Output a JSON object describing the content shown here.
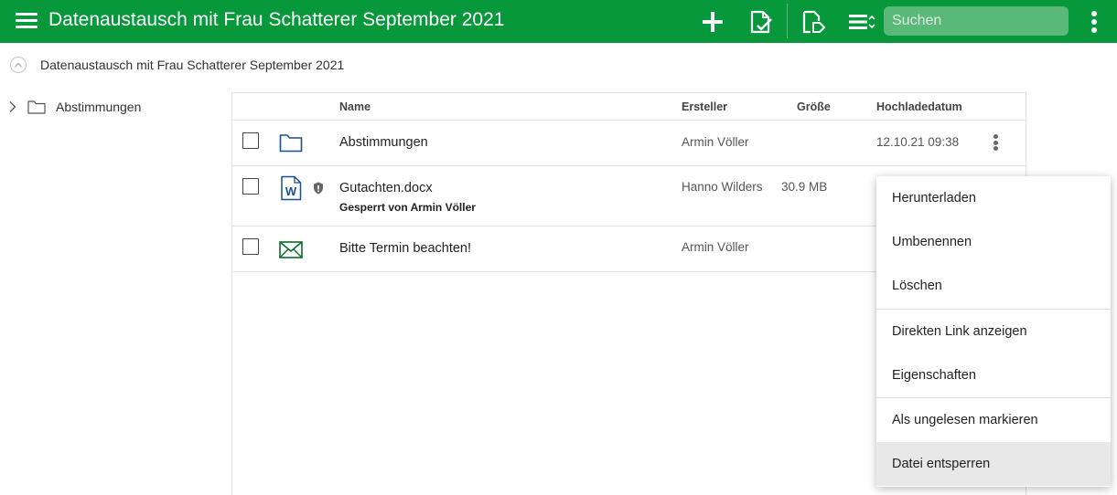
{
  "topbar": {
    "title": "Datenaustausch mit Frau Schatterer September 2021",
    "search_placeholder": "Suchen",
    "color": "#06983a"
  },
  "breadcrumb": {
    "path": "Datenaustausch mit Frau Schatterer September 2021"
  },
  "tree": {
    "items": [
      {
        "label": "Abstimmungen",
        "icon": "folder-icon"
      }
    ]
  },
  "list": {
    "columns": {
      "name": "Name",
      "creator": "Ersteller",
      "size": "Größe",
      "date": "Hochladedatum"
    },
    "rows": [
      {
        "name": "Abstimmungen",
        "sub": "",
        "creator": "Armin Völler",
        "size": "",
        "date": "12.10.21 09:38",
        "icon": "folder-icon"
      },
      {
        "name": "Gutachten.docx",
        "sub": "Gesperrt von Armin Völler",
        "creator": "Hanno Wilders",
        "size": "30.9 MB",
        "date": "",
        "icon": "word-document-icon",
        "locked": true
      },
      {
        "name": "Bitte Termin beachten!",
        "sub": "",
        "creator": "Armin Völler",
        "size": "",
        "date": "",
        "icon": "envelope-icon"
      }
    ]
  },
  "context_menu": {
    "items": [
      {
        "label": "Herunterladen"
      },
      {
        "label": "Umbenennen"
      },
      {
        "label": "Löschen"
      },
      {
        "label": "Direkten Link anzeigen"
      },
      {
        "label": "Eigenschaften"
      },
      {
        "label": "Als ungelesen markieren"
      },
      {
        "label": "Datei entsperren",
        "highlighted": true
      }
    ]
  }
}
